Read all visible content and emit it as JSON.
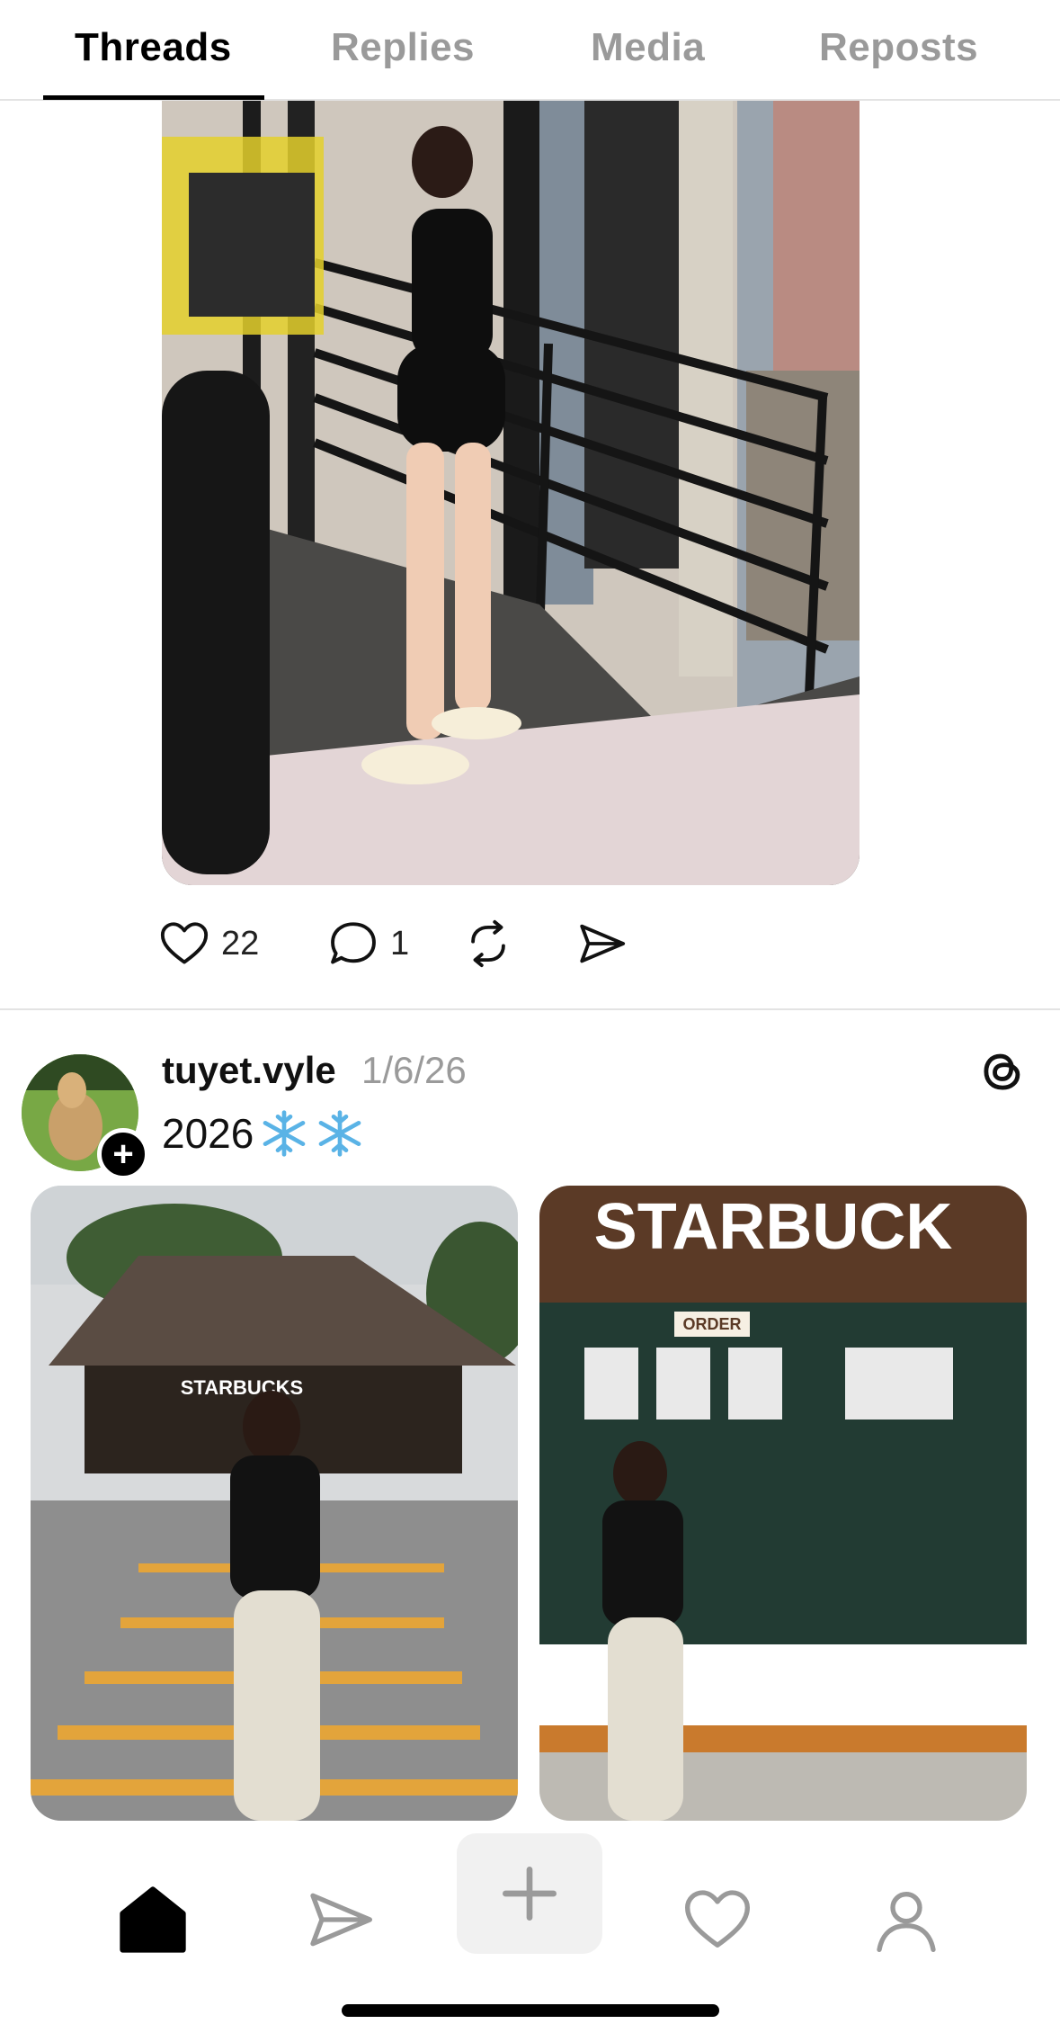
{
  "tabs": [
    {
      "label": "Threads",
      "active": true
    },
    {
      "label": "Replies",
      "active": false
    },
    {
      "label": "Media",
      "active": false
    },
    {
      "label": "Reposts",
      "active": false
    }
  ],
  "post1": {
    "likes": "22",
    "replies": "1"
  },
  "post2": {
    "username": "tuyet.vyle",
    "date": "1/6/26",
    "text": "2026",
    "emoji": [
      "snowflake",
      "snowflake"
    ],
    "image1_sign": "STARBUCKS",
    "image2_sign": "STARBUCK",
    "image2_order_sign": "ORDER"
  },
  "bottom_nav": [
    "home-icon",
    "send-icon",
    "compose-icon",
    "heart-icon",
    "profile-icon"
  ],
  "colors": {
    "active_text": "#000000",
    "inactive_text": "#9a9a9a",
    "divider": "#e3e3e3",
    "compose_bg": "#f1f1f1"
  }
}
